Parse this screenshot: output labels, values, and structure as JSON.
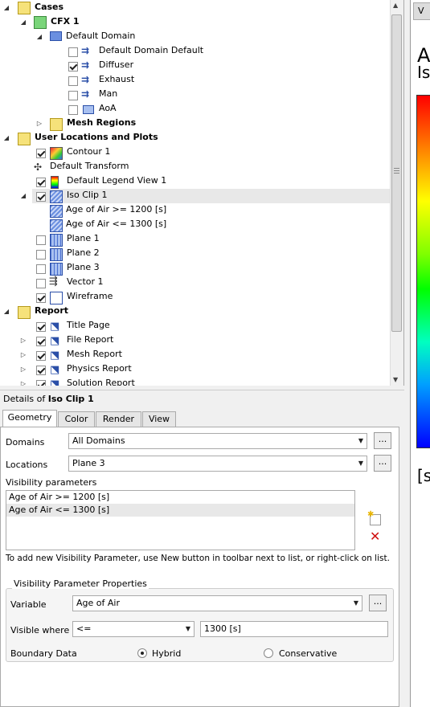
{
  "tree": {
    "items": [
      {
        "label": "Cases",
        "bold": true
      },
      {
        "label": "CFX 1",
        "bold": true
      },
      {
        "label": "Default Domain",
        "bold": false
      },
      {
        "label": "Default Domain Default",
        "bold": false
      },
      {
        "label": "Diffuser",
        "bold": false
      },
      {
        "label": "Exhaust",
        "bold": false
      },
      {
        "label": "Man",
        "bold": false
      },
      {
        "label": "AoA",
        "bold": false
      },
      {
        "label": "Mesh Regions",
        "bold": true
      },
      {
        "label": "User Locations and Plots",
        "bold": true
      },
      {
        "label": "Contour 1",
        "bold": false
      },
      {
        "label": "Default Transform",
        "bold": false
      },
      {
        "label": "Default Legend View 1",
        "bold": false
      },
      {
        "label": "Iso Clip 1",
        "bold": false
      },
      {
        "label": "Age of Air >= 1200 [s]",
        "bold": false
      },
      {
        "label": "Age of Air <= 1300 [s]",
        "bold": false
      },
      {
        "label": "Plane 1",
        "bold": false
      },
      {
        "label": "Plane 2",
        "bold": false
      },
      {
        "label": "Plane 3",
        "bold": false
      },
      {
        "label": "Vector 1",
        "bold": false
      },
      {
        "label": "Wireframe",
        "bold": false
      },
      {
        "label": "Report",
        "bold": true
      },
      {
        "label": "Title Page",
        "bold": false
      },
      {
        "label": "File Report",
        "bold": false
      },
      {
        "label": "Mesh Report",
        "bold": false
      },
      {
        "label": "Physics Report",
        "bold": false
      },
      {
        "label": "Solution Report",
        "bold": false
      }
    ]
  },
  "details": {
    "title_prefix": "Details of ",
    "title_object": "Iso Clip 1",
    "tabs": [
      "Geometry",
      "Color",
      "Render",
      "View"
    ],
    "domains_label": "Domains",
    "domains_value": "All Domains",
    "locations_label": "Locations",
    "locations_value": "Plane 3",
    "visibility_label": "Visibility parameters",
    "visibility_items": [
      "Age of Air >= 1200 [s]",
      "Age of Air <= 1300 [s]"
    ],
    "hint": "To add new Visibility Parameter, use New button in toolbar next to list, or right-click on list.",
    "group_title": "Visibility Parameter Properties",
    "variable_label": "Variable",
    "variable_value": "Age of Air",
    "visible_where_label": "Visible where",
    "visible_where_op": "<=",
    "visible_where_value": "1300 [s]",
    "boundary_label": "Boundary Data",
    "hybrid_label": "Hybrid",
    "conservative_label": "Conservative",
    "dots": "..."
  },
  "viewer": {
    "tab_fragment": "V",
    "legend_char1": "A",
    "legend_char2": "Is",
    "unit_fragment": "[s"
  },
  "colors": {
    "accent": "#3399ff",
    "legend_top": "#ff0000",
    "legend_bottom": "#0000ff"
  }
}
